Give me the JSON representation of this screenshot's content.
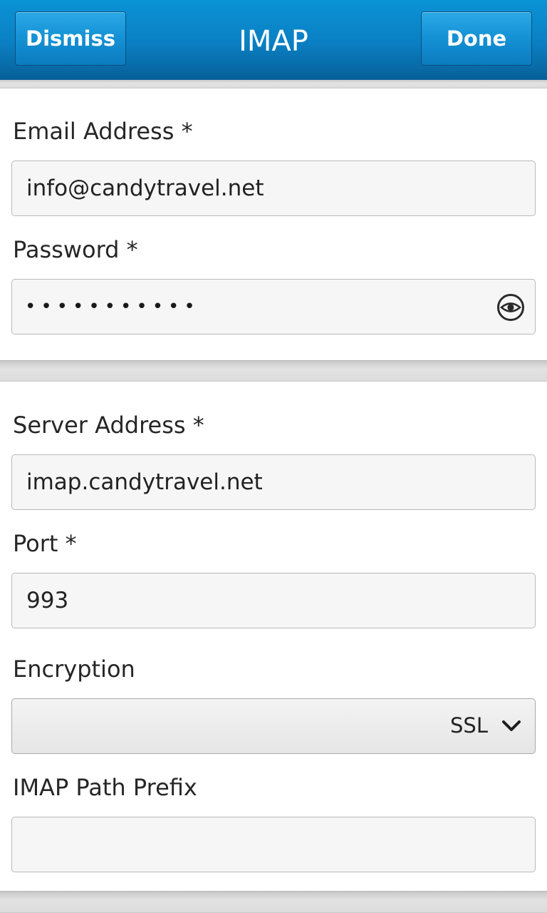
{
  "titlebar": {
    "dismiss_label": "Dismiss",
    "title": "IMAP",
    "done_label": "Done"
  },
  "account": {
    "email_label": "Email Address *",
    "email_value": "info@candytravel.net",
    "password_label": "Password *",
    "password_value": "•••••••••••",
    "password_toggle_icon": "eye-icon"
  },
  "server": {
    "server_label": "Server Address *",
    "server_value": "imap.candytravel.net",
    "port_label": "Port *",
    "port_value": "993",
    "encryption_label": "Encryption",
    "encryption_value": "SSL",
    "encryption_dropdown_icon": "chevron-down-icon",
    "prefix_label": "IMAP Path Prefix",
    "prefix_value": ""
  },
  "colors": {
    "titlebar": "#0a84c8",
    "button_border": "#0b4f80",
    "separator": "#dcdcdc",
    "field_bg": "#f6f6f6",
    "field_border": "#b9b9b9",
    "text": "#262626"
  }
}
